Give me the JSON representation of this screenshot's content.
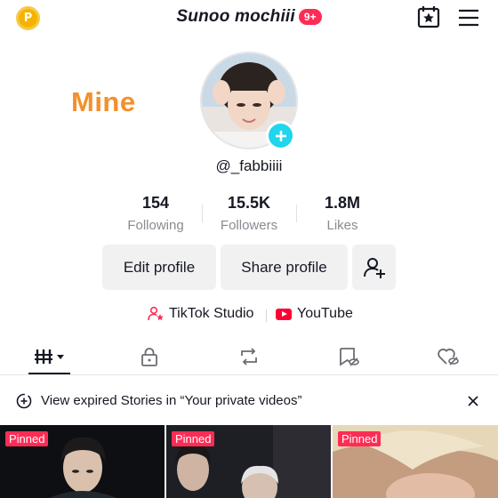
{
  "header": {
    "coin_letter": "P",
    "title": "Sunoo mochiii",
    "notification_badge": "9+"
  },
  "sticker_text": "Mine",
  "profile": {
    "username": "@_fabbiiii"
  },
  "stats": [
    {
      "value": "154",
      "label": "Following"
    },
    {
      "value": "15.5K",
      "label": "Followers"
    },
    {
      "value": "1.8M",
      "label": "Likes"
    }
  ],
  "actions": {
    "edit_profile": "Edit profile",
    "share_profile": "Share profile"
  },
  "links": {
    "studio": "TikTok Studio",
    "youtube": "YouTube"
  },
  "banner": {
    "text": "View expired Stories in “Your private videos”"
  },
  "videos": [
    {
      "badge": "Pinned"
    },
    {
      "badge": "Pinned"
    },
    {
      "badge": "Pinned"
    }
  ],
  "colors": {
    "accent": "#fe2c55",
    "avatar_plus": "#20d5ec",
    "sticker": "#f4902a",
    "coin": "#f5b301"
  }
}
